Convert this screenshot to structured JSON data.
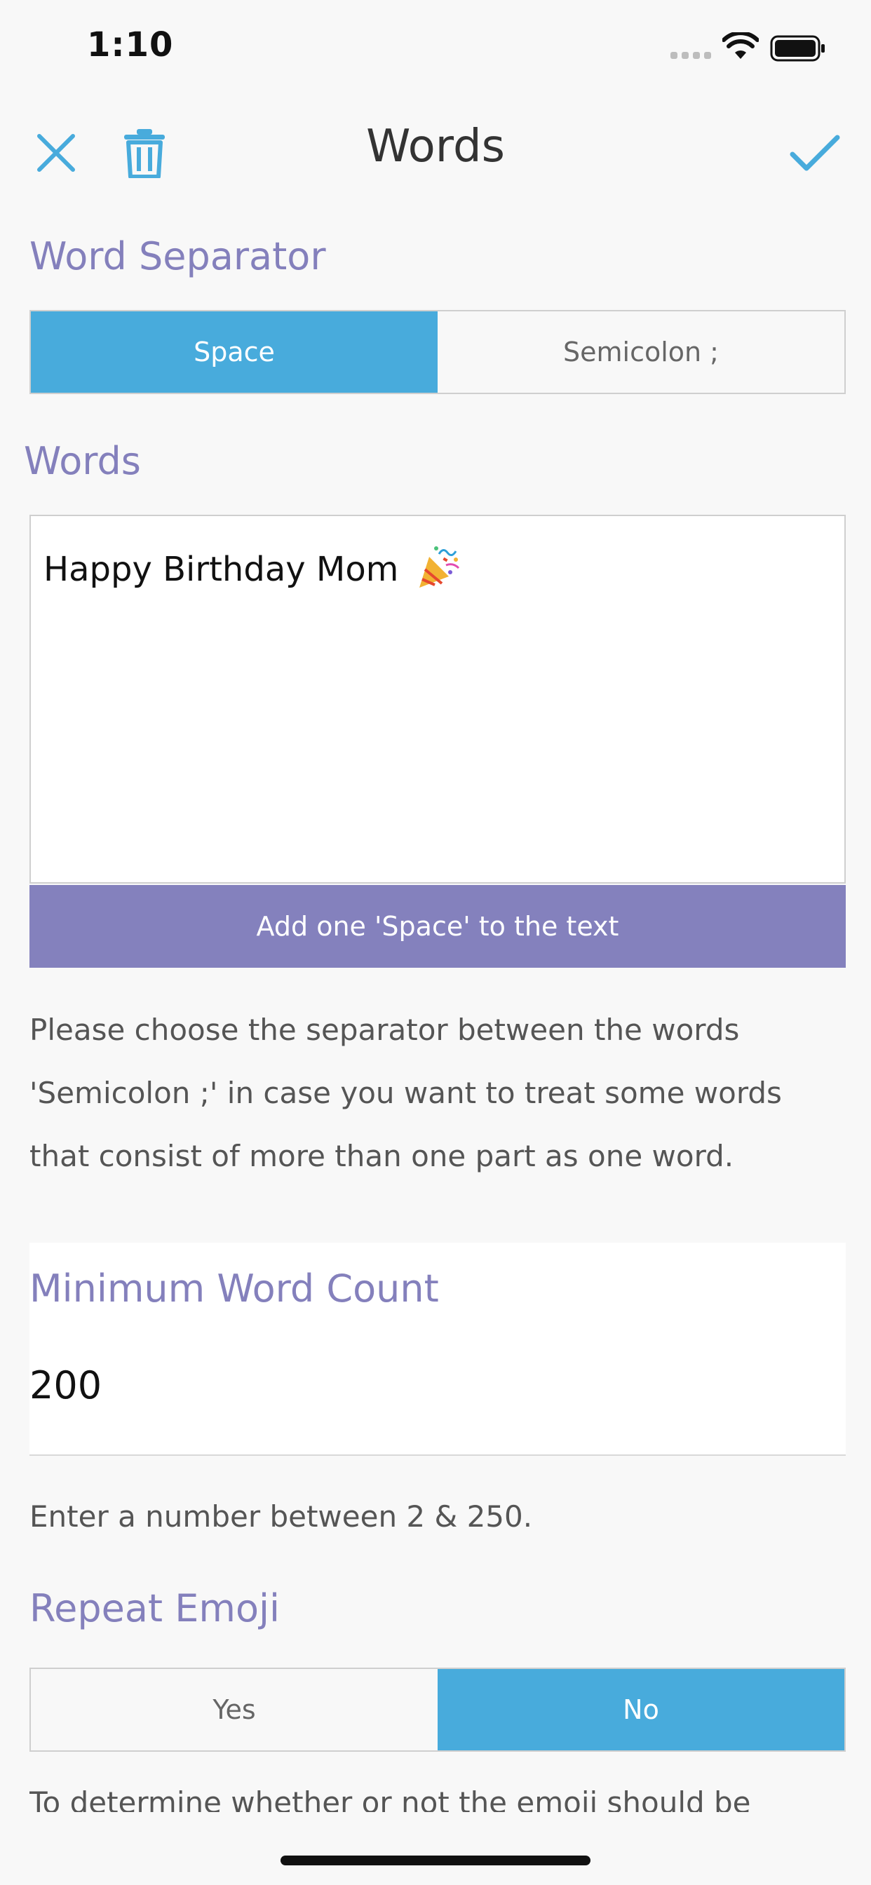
{
  "status_bar": {
    "time": "1:10"
  },
  "nav": {
    "title": "Words"
  },
  "word_separator": {
    "title": "Word Separator",
    "options": [
      "Space",
      "Semicolon ;"
    ],
    "selected": "Space"
  },
  "words": {
    "title": "Words",
    "value": "Happy Birthday Mom",
    "emoji": "party-popper-emoji",
    "add_button_label": "Add one 'Space' to the text"
  },
  "separator_help": "Please choose the separator between the words 'Semicolon ;' in case you want to treat some words that consist of more than one part as one word.",
  "min_word_count": {
    "title": "Minimum Word Count",
    "value": "200",
    "help": "Enter a number between 2 & 250."
  },
  "repeat_emoji": {
    "title": "Repeat Emoji",
    "options": [
      "Yes",
      "No"
    ],
    "selected": "No"
  },
  "truncated_text": "To determine whether or not the emoji should be",
  "colors": {
    "accent_blue": "#48abdc",
    "accent_purple": "#8481bd",
    "background": "#f8f8f8"
  }
}
